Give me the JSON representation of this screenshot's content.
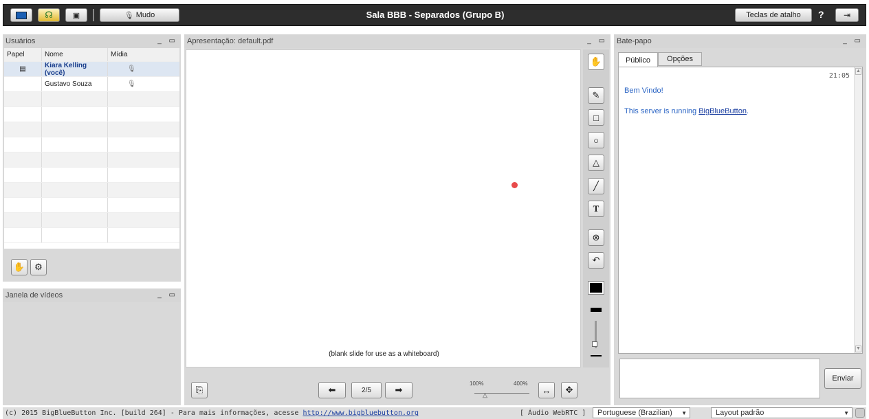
{
  "topbar": {
    "title": "Sala BBB - Separados (Grupo B)",
    "mute_label": "Mudo",
    "shortcuts_label": "Teclas de atalho",
    "help_label": "?"
  },
  "users": {
    "title": "Usuários",
    "col_role": "Papel",
    "col_name": "Nome",
    "col_media": "Mídia",
    "rows": [
      {
        "name": "Kiara Kelling (você)"
      },
      {
        "name": "Gustavo Souza"
      }
    ]
  },
  "video": {
    "title": "Janela de vídeos"
  },
  "presentation": {
    "title": "Apresentação: default.pdf",
    "slide_caption": "(blank slide for use as a whiteboard)",
    "page": "2/5",
    "zoom_min": "100%",
    "zoom_max": "400%"
  },
  "chat": {
    "title": "Bate-papo",
    "tab_public": "Público",
    "tab_options": "Opções",
    "time": "21:05",
    "welcome": "Bem Vindo!",
    "server_prefix": "This server is running ",
    "server_link": "BigBlueButton",
    "server_suffix": ".",
    "send_label": "Enviar"
  },
  "footer": {
    "copyright": "(c) 2015 BigBlueButton Inc. [build 264] - Para mais informações, acesse ",
    "link": "http://www.bigbluebutton.org",
    "audio": "[ Áudio WebRTC ]",
    "language": "Portuguese (Brazilian)",
    "layout": "Layout padrão"
  }
}
